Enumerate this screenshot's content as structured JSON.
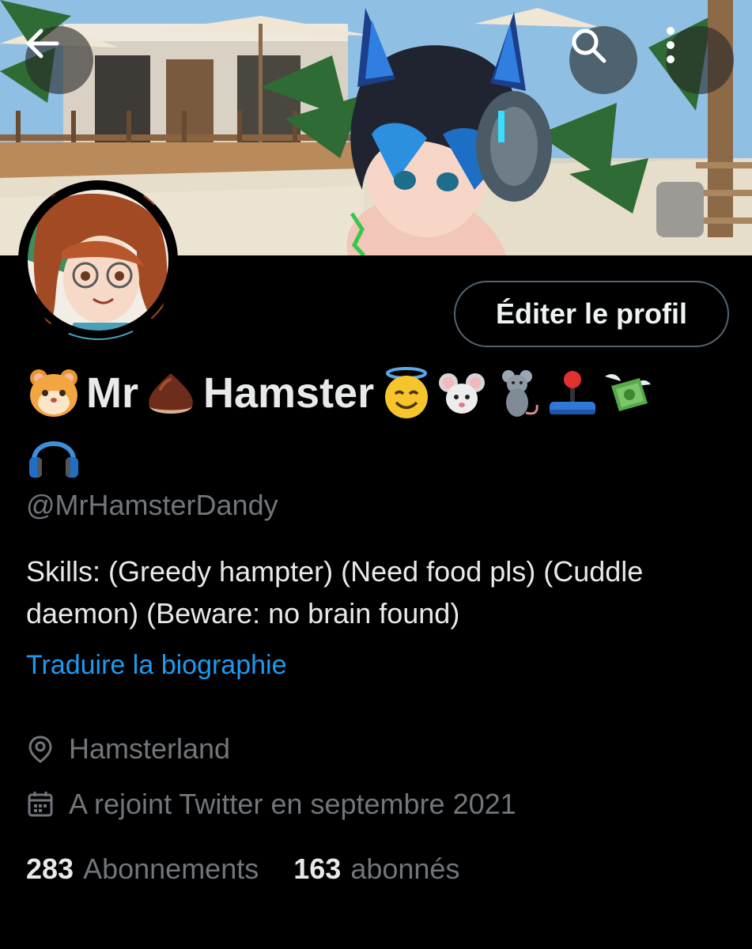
{
  "header": {
    "back_icon": "arrow-left-icon",
    "search_icon": "magnifier-icon",
    "more_icon": "vertical-ellipsis-icon"
  },
  "profile": {
    "edit_label": "Éditer le profil",
    "name_word_1": "Mr",
    "name_word_2": "Hamster",
    "name_emojis": [
      "hamster-face",
      "chestnut",
      "smiling-face-with-halo",
      "mouse-face",
      "rat",
      "joystick",
      "money-with-wings",
      "headphones"
    ],
    "handle": "@MrHamsterDandy",
    "bio": "Skills: (Greedy hampter) (Need food pls) (Cuddle daemon) (Beware: no brain found)",
    "translate_label": "Traduire la biographie",
    "location": "Hamsterland",
    "joined": "A rejoint Twitter en septembre 2021",
    "following_count": "283",
    "following_label": "Abonnements",
    "followers_count": "163",
    "followers_label": "abonnés"
  },
  "colors": {
    "background": "#000000",
    "primary_text": "#e7e9ea",
    "secondary_text": "#71767b",
    "link": "#1d9bf0",
    "button_border": "#536471"
  }
}
